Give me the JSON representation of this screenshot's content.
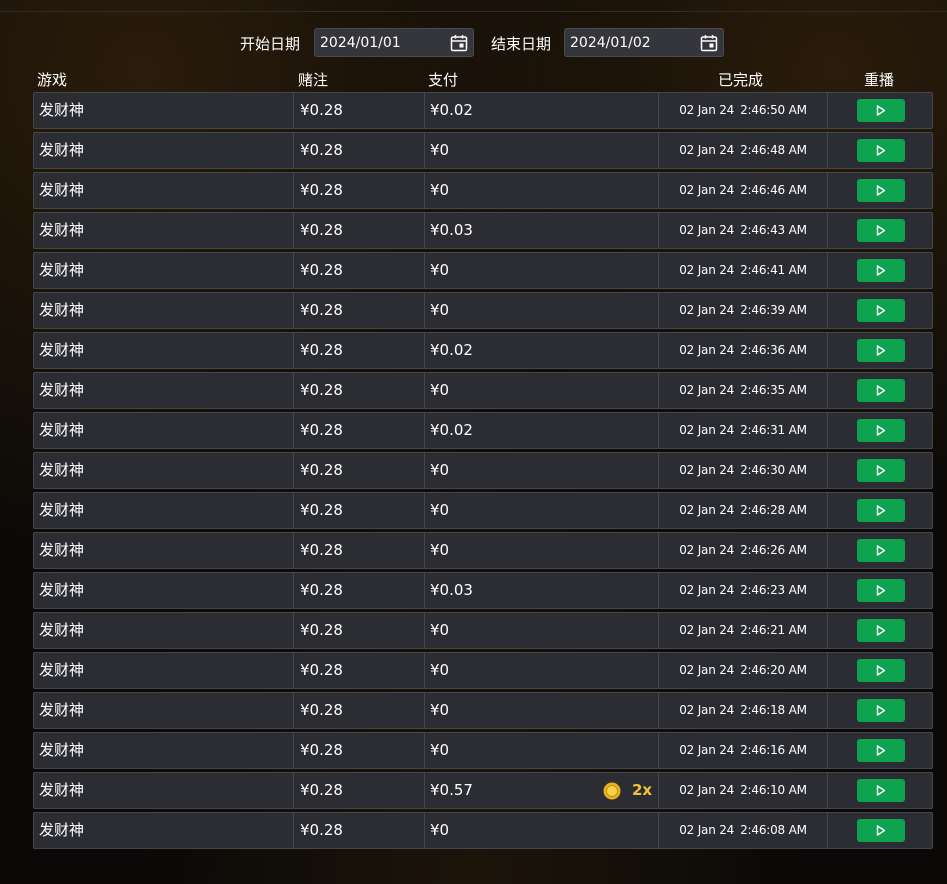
{
  "filters": {
    "start_label": "开始日期",
    "start_value": "2024/01/01",
    "end_label": "结束日期",
    "end_value": "2024/01/02"
  },
  "columns": {
    "game": "游戏",
    "bet": "赌注",
    "payout": "支付",
    "completed": "已完成",
    "replay": "重播"
  },
  "colors": {
    "row_bg": "#2c2d32",
    "replay_button": "#0ea34f",
    "multiplier": "#f2c13c"
  },
  "rows": [
    {
      "game": "发财神",
      "bet": "¥0.28",
      "payout": "¥0.02",
      "date": "02 Jan 24",
      "time": "2:46:50 AM"
    },
    {
      "game": "发财神",
      "bet": "¥0.28",
      "payout": "¥0",
      "date": "02 Jan 24",
      "time": "2:46:48 AM"
    },
    {
      "game": "发财神",
      "bet": "¥0.28",
      "payout": "¥0",
      "date": "02 Jan 24",
      "time": "2:46:46 AM"
    },
    {
      "game": "发财神",
      "bet": "¥0.28",
      "payout": "¥0.03",
      "date": "02 Jan 24",
      "time": "2:46:43 AM"
    },
    {
      "game": "发财神",
      "bet": "¥0.28",
      "payout": "¥0",
      "date": "02 Jan 24",
      "time": "2:46:41 AM"
    },
    {
      "game": "发财神",
      "bet": "¥0.28",
      "payout": "¥0",
      "date": "02 Jan 24",
      "time": "2:46:39 AM"
    },
    {
      "game": "发财神",
      "bet": "¥0.28",
      "payout": "¥0.02",
      "date": "02 Jan 24",
      "time": "2:46:36 AM"
    },
    {
      "game": "发财神",
      "bet": "¥0.28",
      "payout": "¥0",
      "date": "02 Jan 24",
      "time": "2:46:35 AM"
    },
    {
      "game": "发财神",
      "bet": "¥0.28",
      "payout": "¥0.02",
      "date": "02 Jan 24",
      "time": "2:46:31 AM"
    },
    {
      "game": "发财神",
      "bet": "¥0.28",
      "payout": "¥0",
      "date": "02 Jan 24",
      "time": "2:46:30 AM"
    },
    {
      "game": "发财神",
      "bet": "¥0.28",
      "payout": "¥0",
      "date": "02 Jan 24",
      "time": "2:46:28 AM"
    },
    {
      "game": "发财神",
      "bet": "¥0.28",
      "payout": "¥0",
      "date": "02 Jan 24",
      "time": "2:46:26 AM"
    },
    {
      "game": "发财神",
      "bet": "¥0.28",
      "payout": "¥0.03",
      "date": "02 Jan 24",
      "time": "2:46:23 AM"
    },
    {
      "game": "发财神",
      "bet": "¥0.28",
      "payout": "¥0",
      "date": "02 Jan 24",
      "time": "2:46:21 AM"
    },
    {
      "game": "发财神",
      "bet": "¥0.28",
      "payout": "¥0",
      "date": "02 Jan 24",
      "time": "2:46:20 AM"
    },
    {
      "game": "发财神",
      "bet": "¥0.28",
      "payout": "¥0",
      "date": "02 Jan 24",
      "time": "2:46:18 AM"
    },
    {
      "game": "发财神",
      "bet": "¥0.28",
      "payout": "¥0",
      "date": "02 Jan 24",
      "time": "2:46:16 AM"
    },
    {
      "game": "发财神",
      "bet": "¥0.28",
      "payout": "¥0.57",
      "multiplier": "2x",
      "icon": "coin-icon",
      "date": "02 Jan 24",
      "time": "2:46:10 AM"
    },
    {
      "game": "发财神",
      "bet": "¥0.28",
      "payout": "¥0",
      "date": "02 Jan 24",
      "time": "2:46:08 AM"
    }
  ]
}
